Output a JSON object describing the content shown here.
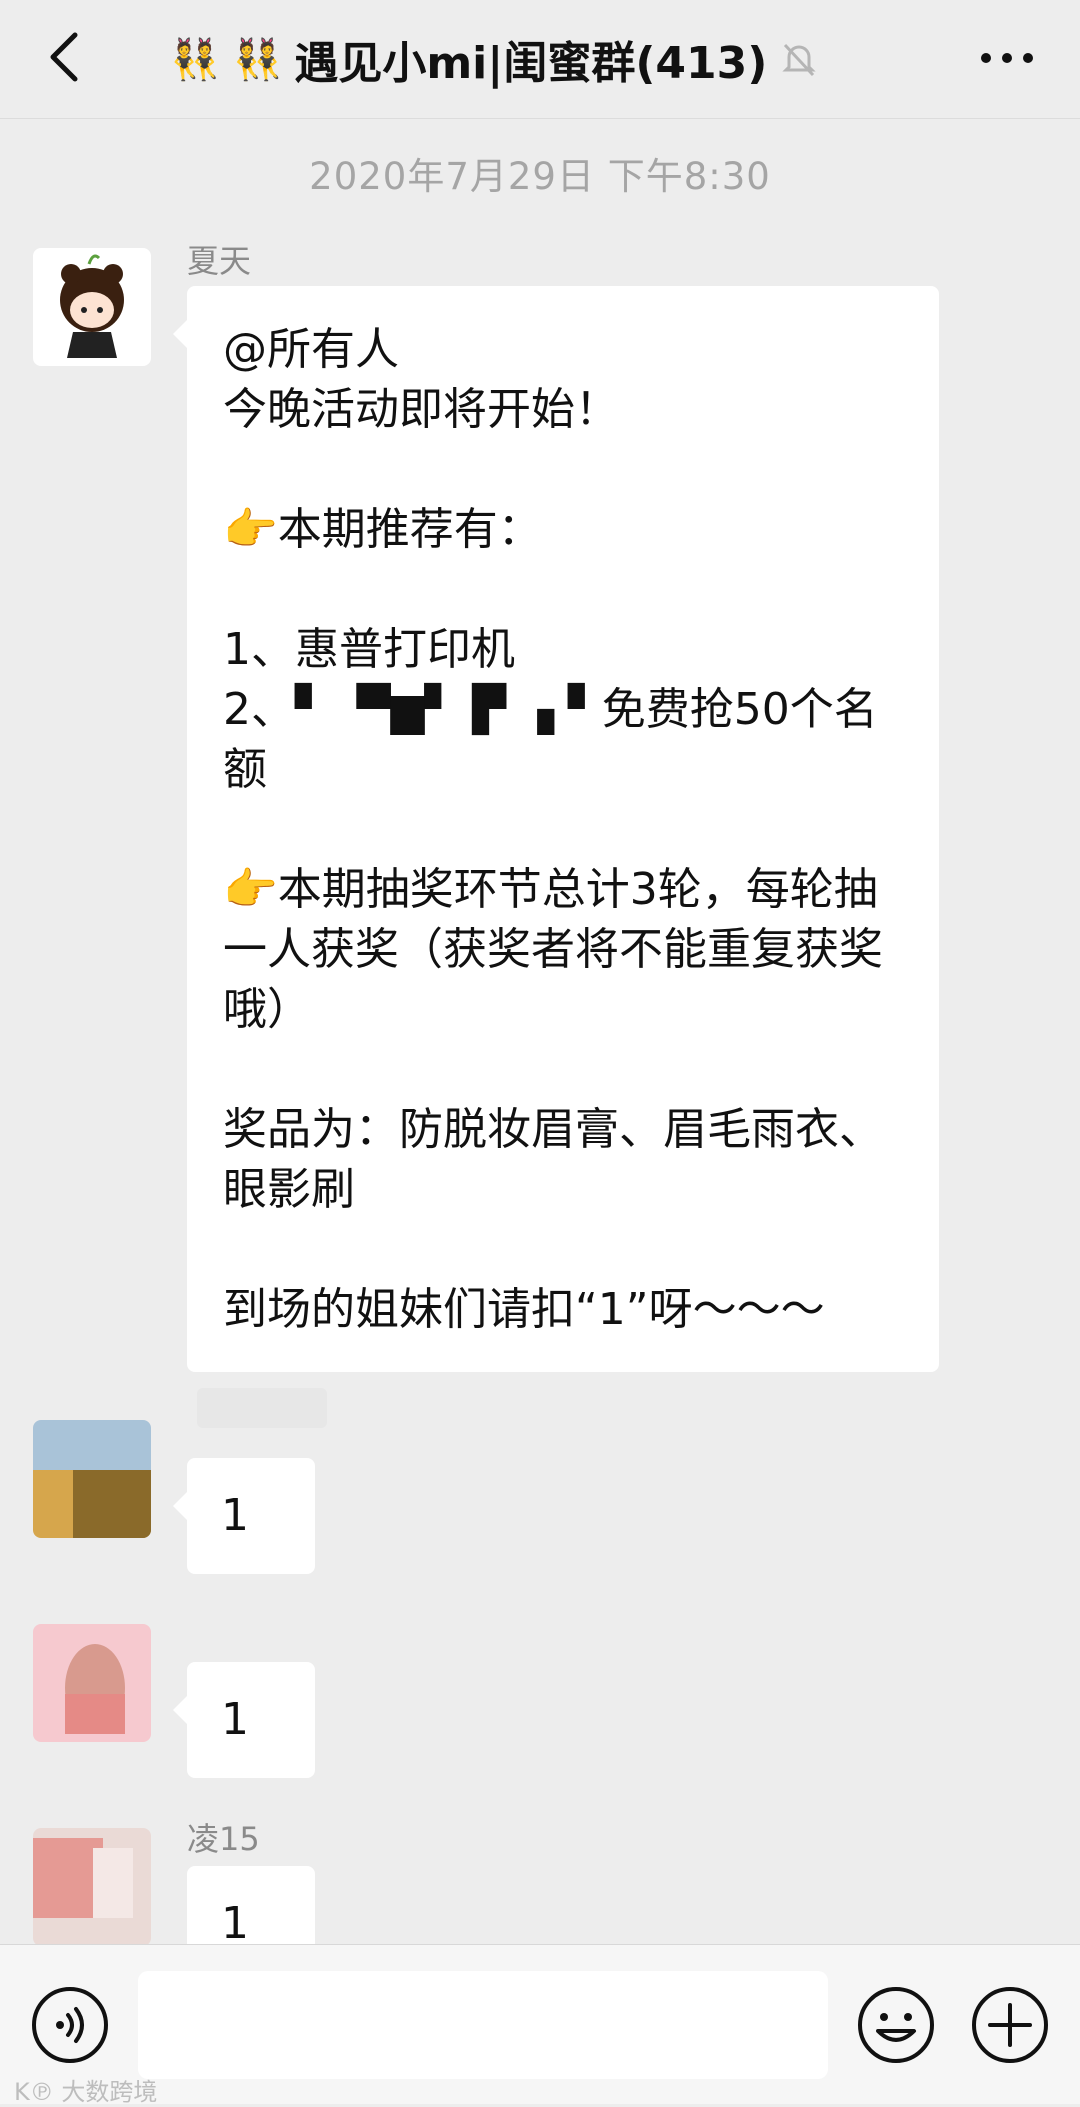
{
  "header": {
    "title": "遇见小mi|闺蜜群(413)",
    "title_emoji": "👯 👯",
    "back_icon": "chevron-left-icon",
    "muted_icon": "bell-off-icon",
    "more_icon": "ellipsis-icon"
  },
  "timestamp": "2020年7月29日 下午8:30",
  "messages": [
    {
      "sender": "夏天",
      "text": "@所有人\n今晚活动即将开始！\n\n👉本期推荐有：\n\n1、惠普打印机\n2、▘  ▀▆▘ ▛ ▗ ▘免费抢50个名额\n\n👉本期抽奖环节总计3轮，每轮抽一人获奖（获奖者将不能重复获奖哦）\n\n奖品为：防脱妆眉膏、眉毛雨衣、眼影刷\n\n到场的姐妹们请扣“1”呀～～～"
    },
    {
      "sender": "",
      "text": "1"
    },
    {
      "sender": "",
      "text": "1"
    },
    {
      "sender": "凌15",
      "text": "1"
    }
  ],
  "input": {
    "placeholder": "",
    "value": ""
  },
  "watermark": "K℗ 大数跨境",
  "colors": {
    "background": "#ededed",
    "bubble": "#ffffff",
    "header_text": "#111111",
    "timestamp": "#a5a5a5"
  }
}
